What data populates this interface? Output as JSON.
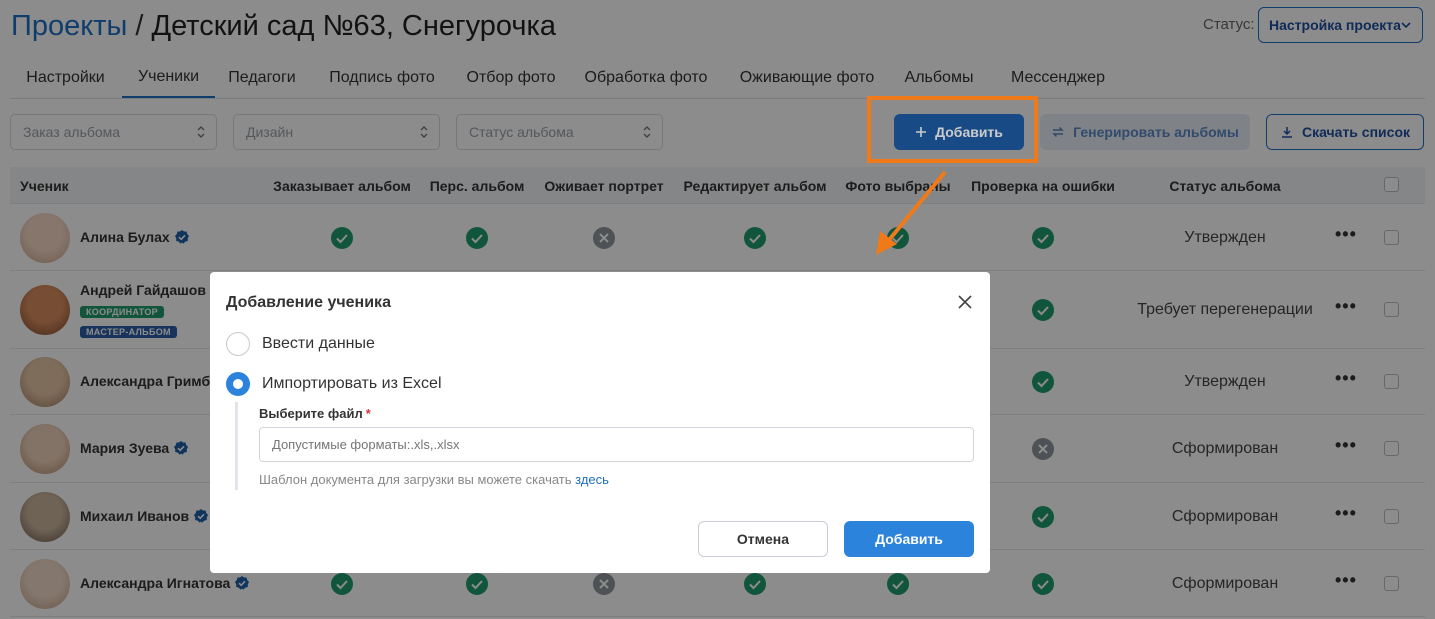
{
  "header": {
    "breadcrumb": "Проекты",
    "separator": "/",
    "project_title": "Детский сад №63, Снегурочка",
    "status_label": "Статус:",
    "status_value": "Настройка проекта"
  },
  "tabs": [
    {
      "label": "Настройки",
      "active": false
    },
    {
      "label": "Ученики",
      "active": true
    },
    {
      "label": "Педагоги",
      "active": false
    },
    {
      "label": "Подпись фото",
      "active": false
    },
    {
      "label": "Отбор фото",
      "active": false
    },
    {
      "label": "Обработка фото",
      "active": false
    },
    {
      "label": "Оживающие фото",
      "active": false
    },
    {
      "label": "Альбомы",
      "active": false
    },
    {
      "label": "Мессенджер",
      "active": false
    }
  ],
  "filters": [
    {
      "placeholder": "Заказ альбома"
    },
    {
      "placeholder": "Дизайн"
    },
    {
      "placeholder": "Статус альбома"
    }
  ],
  "toolbar": {
    "add_label": "Добавить",
    "generate_label": "Генерировать альбомы",
    "download_label": "Скачать список"
  },
  "table": {
    "headers": [
      "Ученик",
      "Заказывает альбом",
      "Перс. альбом",
      "Оживает портрет",
      "Редактирует альбом",
      "Фото выбраны",
      "Проверка на ошибки",
      "Статус альбома"
    ],
    "rows": [
      {
        "name": "Алина Булах",
        "tags": [],
        "marks": [
          "yes",
          "yes",
          "no",
          "yes",
          "yes",
          "yes"
        ],
        "status": "Утвержден"
      },
      {
        "name": "Андрей Гайдашов",
        "tags": [
          "КООРДИНАТОР",
          "МАСТЕР-АЛЬБОМ"
        ],
        "marks": [
          "",
          "",
          "",
          "",
          "",
          "yes"
        ],
        "status": "Требует перегенерации"
      },
      {
        "name": "Александра Гримбе",
        "tags": [],
        "marks": [
          "",
          "",
          "",
          "",
          "",
          "yes"
        ],
        "status": "Утвержден"
      },
      {
        "name": "Мария Зуева",
        "tags": [],
        "marks": [
          "",
          "",
          "",
          "",
          "",
          "no"
        ],
        "status": "Сформирован"
      },
      {
        "name": "Михаил Иванов",
        "tags": [],
        "marks": [
          "",
          "",
          "",
          "",
          "",
          "yes"
        ],
        "status": "Сформирован"
      },
      {
        "name": "Александра Игнатова",
        "tags": [],
        "marks": [
          "yes",
          "yes",
          "no",
          "yes",
          "yes",
          "yes"
        ],
        "status": "Сформирован"
      }
    ]
  },
  "modal": {
    "title": "Добавление ученика",
    "option_manual": "Ввести данные",
    "option_excel": "Импортировать из Excel",
    "selected_option": "excel",
    "file_label": "Выберите файл",
    "required_mark": "*",
    "file_placeholder": "Допустимые форматы:.xls,.xlsx",
    "hint_text": "Шаблон документа для загрузки вы можете скачать",
    "hint_link": "здесь",
    "cancel_label": "Отмена",
    "submit_label": "Добавить"
  },
  "colors": {
    "accent": "#1f6fc7",
    "primary_button": "#2b83db",
    "highlight": "#f07a1a",
    "success": "#1f9d6e",
    "muted": "#9aa0a8"
  }
}
